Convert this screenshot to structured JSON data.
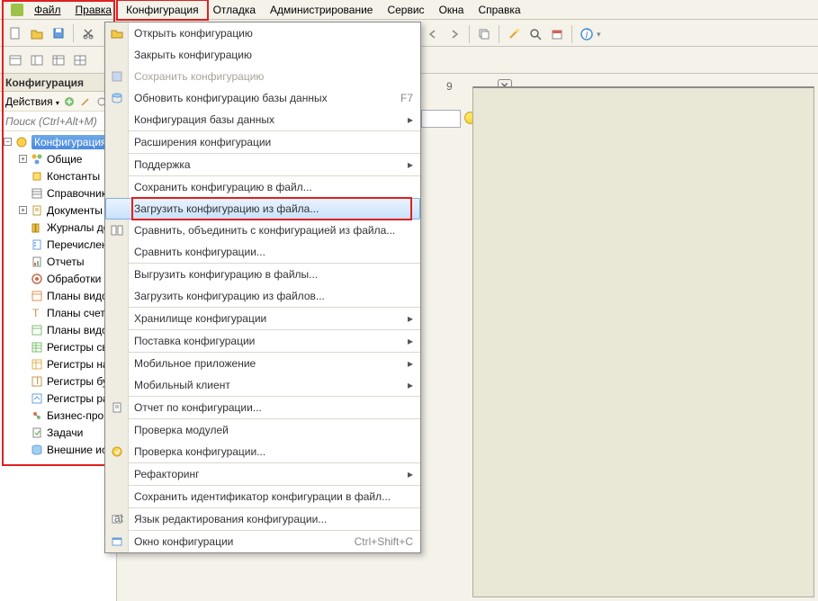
{
  "menubar": {
    "file": "Файл",
    "edit": "Правка",
    "configuration": "Конфигурация",
    "debug": "Отладка",
    "administration": "Администрирование",
    "service": "Сервис",
    "windows": "Окна",
    "help": "Справка"
  },
  "sidebar": {
    "title": "Конфигурация",
    "actions_label": "Действия",
    "search_placeholder": "Поиск (Ctrl+Alt+M)",
    "root": "Конфигурация",
    "items": [
      "Общие",
      "Константы",
      "Справочники",
      "Документы",
      "Журналы документов",
      "Перечисления",
      "Отчеты",
      "Обработки",
      "Планы видов",
      "Планы счетов",
      "Планы видов",
      "Регистры сведений",
      "Регистры накопления",
      "Регистры бухгалтерии",
      "Регистры расчета",
      "Бизнес-процессы",
      "Задачи",
      "Внешние источники"
    ]
  },
  "dropdown": {
    "open": "Открыть конфигурацию",
    "close": "Закрыть конфигурацию",
    "save": "Сохранить конфигурацию",
    "update_db": "Обновить конфигурацию базы данных",
    "update_db_shortcut": "F7",
    "db_config": "Конфигурация базы данных",
    "extensions": "Расширения конфигурации",
    "support": "Поддержка",
    "save_to_file": "Сохранить конфигурацию в файл...",
    "load_from_file": "Загрузить конфигурацию из файла...",
    "compare_merge": "Сравнить, объединить с конфигурацией из файла...",
    "compare": "Сравнить конфигурации...",
    "export_files": "Выгрузить конфигурацию в файлы...",
    "import_files": "Загрузить конфигурацию из файлов...",
    "repository": "Хранилище конфигурации",
    "delivery": "Поставка конфигурации",
    "mobile_app": "Мобильное приложение",
    "mobile_client": "Мобильный клиент",
    "report": "Отчет по конфигурации...",
    "check_modules": "Проверка модулей",
    "check_config": "Проверка конфигурации...",
    "refactoring": "Рефакторинг",
    "save_id": "Сохранить идентификатор конфигурации в файл...",
    "edit_lang": "Язык редактирования конфигурации...",
    "config_window": "Окно конфигурации",
    "config_window_shortcut": "Ctrl+Shift+C"
  },
  "right": {
    "tab_number": "9"
  }
}
